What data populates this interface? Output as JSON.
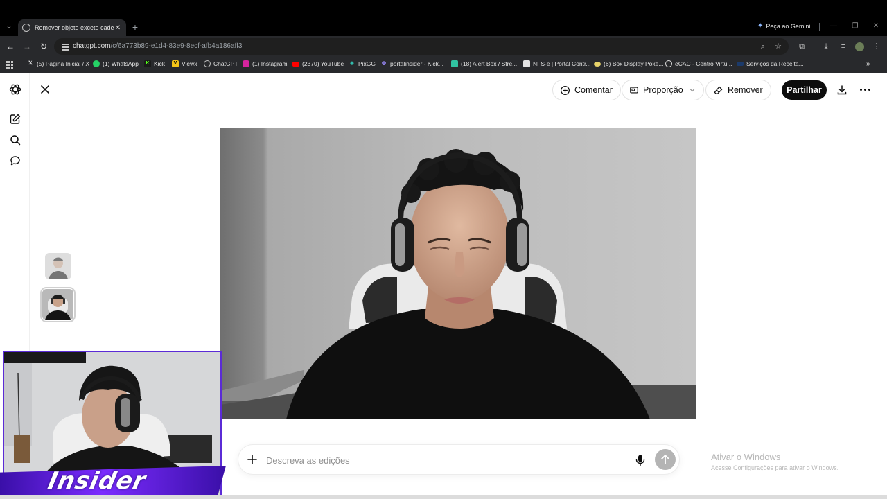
{
  "browser": {
    "tab_title": "Remover objeto exceto cadeira",
    "new_tab_symbol": "+",
    "gemini_label": "Peça ao Gemini",
    "url_host": "chatgpt.com",
    "url_path": "/c/6a773b89-e1d4-83e9-8ecf-afb4a186aff3",
    "bookmarks": [
      {
        "label": "(5) Página Inicial / X",
        "icon": "x-icon",
        "color": "#000000"
      },
      {
        "label": "(1) WhatsApp",
        "icon": "whatsapp-icon",
        "color": "#25d366"
      },
      {
        "label": "Kick",
        "icon": "kick-icon",
        "color": "#53fc18"
      },
      {
        "label": "Viewx",
        "icon": "viewx-icon",
        "color": "#f5c518"
      },
      {
        "label": "ChatGPT",
        "icon": "chatgpt-icon",
        "color": "#9a9a9a"
      },
      {
        "label": "(1) Instagram",
        "icon": "instagram-icon",
        "color": "#d6249f"
      },
      {
        "label": "(2370) YouTube",
        "icon": "youtube-icon",
        "color": "#ff0000"
      },
      {
        "label": "PixGG",
        "icon": "pixgg-icon",
        "color": "#32bcad"
      },
      {
        "label": "portalinsider - Kick...",
        "icon": "portalinsider-icon",
        "color": "#7b61ff"
      },
      {
        "label": "(18) Alert Box / Stre...",
        "icon": "alertbox-icon",
        "color": "#31c3a2"
      },
      {
        "label": "NFS-e | Portal Contr...",
        "icon": "nfse-icon",
        "color": "#1a5fb4"
      },
      {
        "label": "(6) Box Display Poké...",
        "icon": "pokemon-icon",
        "color": "#e8d36a"
      },
      {
        "label": "eCAC - Centro Virtu...",
        "icon": "ecac-icon",
        "color": "#5f6368"
      },
      {
        "label": "Serviços da Receita...",
        "icon": "receita-icon",
        "color": "#1b3a6b"
      }
    ],
    "bookmarks_more": "»"
  },
  "app": {
    "toolbar": {
      "comment_label": "Comentar",
      "aspect_label": "Proporção",
      "remove_label": "Remover",
      "share_label": "Partilhar"
    },
    "composer": {
      "placeholder": "Descreva as edições"
    }
  },
  "watermark": {
    "title": "Ativar o Windows",
    "subtitle": "Acesse Configurações para ativar o Windows."
  },
  "overlay": {
    "logo_text": "Insider"
  },
  "colors": {
    "accent_dark": "#0d0d0d",
    "overlay_border": "#5b2bd6",
    "browser_frame": "#28292c"
  }
}
